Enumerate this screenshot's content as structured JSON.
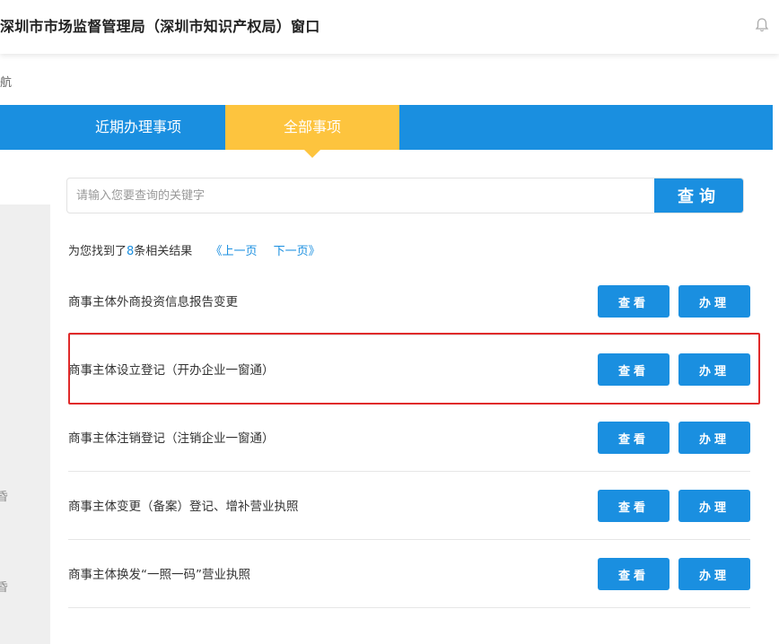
{
  "header": {
    "title": "深圳市市场监督管理局（深圳市知识产权局）窗口",
    "notification_icon": "bell-icon"
  },
  "breadcrumb": {
    "text": "航"
  },
  "tabs": [
    {
      "label": "近期办理事项",
      "active": false
    },
    {
      "label": "全部事项",
      "active": true
    }
  ],
  "colors": {
    "accent": "#1a8fe0",
    "active_tab": "#fdc43e",
    "highlight": "#e02a2a"
  },
  "sidebar": {
    "glyphs": [
      "昏",
      "昏"
    ]
  },
  "search": {
    "placeholder": "请输入您要查询的关键字",
    "value": "",
    "button_label": "查询"
  },
  "results": {
    "prefix": "为您找到了",
    "count": "8",
    "suffix": "条相关结果",
    "prev_label": "《上一页",
    "next_label": "下一页》"
  },
  "items": [
    {
      "title": "商事主体外商投资信息报告变更",
      "view_label": "查看",
      "handle_label": "办理"
    },
    {
      "title": "商事主体设立登记（开办企业一窗通）",
      "view_label": "查看",
      "handle_label": "办理",
      "highlighted": true
    },
    {
      "title": "商事主体注销登记（注销企业一窗通）",
      "view_label": "查看",
      "handle_label": "办理"
    },
    {
      "title": "商事主体变更（备案）登记、增补营业执照",
      "view_label": "查看",
      "handle_label": "办理"
    },
    {
      "title": "商事主体换发“一照一码”营业执照",
      "view_label": "查看",
      "handle_label": "办理"
    }
  ]
}
